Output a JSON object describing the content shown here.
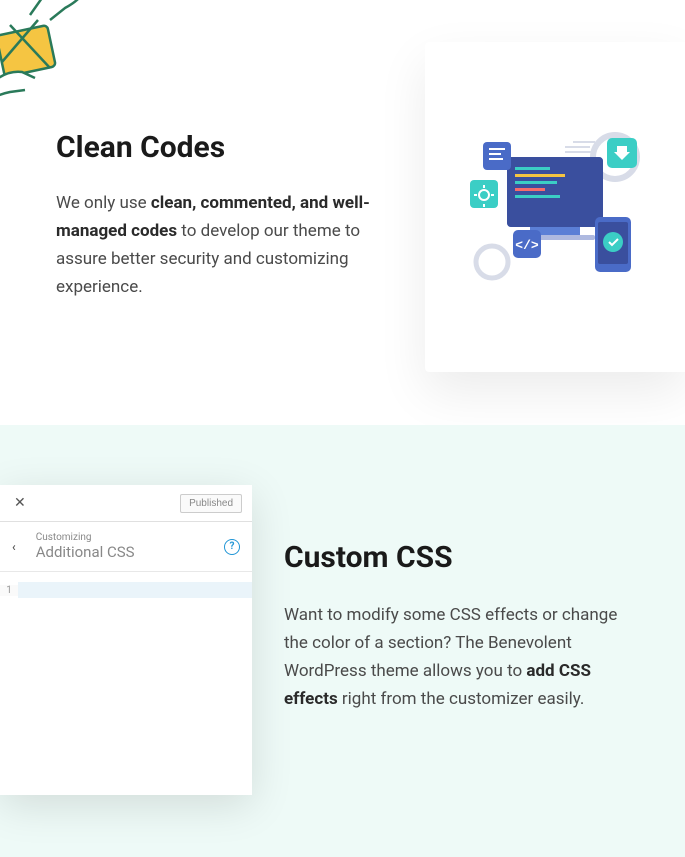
{
  "section1": {
    "heading": "Clean Codes",
    "para_prefix": "We only use ",
    "para_bold": "clean, commented, and well-managed codes",
    "para_suffix": " to develop our theme to assure better security and customizing experience."
  },
  "section2": {
    "heading": "Custom CSS",
    "para_prefix": "Want to modify some CSS effects or change the color of a section? The Benevolent WordPress theme allows you to ",
    "para_bold": "add CSS effects",
    "para_suffix": " right from the customizer easily."
  },
  "customizer": {
    "published_label": "Published",
    "customizing_label": "Customizing",
    "panel_title": "Additional CSS",
    "line_number": "1"
  }
}
